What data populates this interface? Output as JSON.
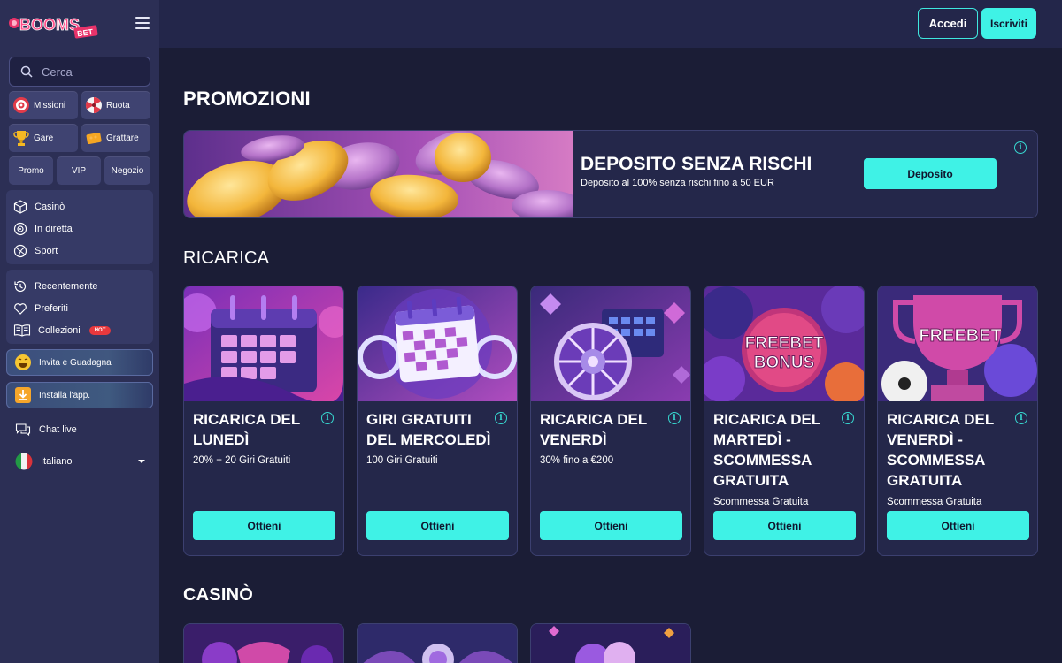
{
  "brand": {
    "logo_text": "BOOMS",
    "logo_tag": "BET"
  },
  "search": {
    "placeholder": "Cerca"
  },
  "quick_tiles": [
    {
      "label": "Missioni",
      "icon": "target-icon"
    },
    {
      "label": "Ruota",
      "icon": "wheel-icon"
    },
    {
      "label": "Gare",
      "icon": "trophy-icon"
    },
    {
      "label": "Grattare",
      "icon": "scratch-card-icon"
    }
  ],
  "small_tiles": [
    "Promo",
    "VIP",
    "Negozio"
  ],
  "nav_primary": [
    {
      "label": "Casinò",
      "icon": "dice-icon"
    },
    {
      "label": "In diretta",
      "icon": "live-icon"
    },
    {
      "label": "Sport",
      "icon": "ball-icon"
    }
  ],
  "nav_secondary": [
    {
      "label": "Recentemente",
      "icon": "history-icon"
    },
    {
      "label": "Preferiti",
      "icon": "heart-icon"
    },
    {
      "label": "Collezioni",
      "icon": "book-icon",
      "badge": "HOT"
    }
  ],
  "invite": {
    "label": "Invita e Guadagna"
  },
  "install": {
    "label": "Installa l'app."
  },
  "chat": {
    "label": "Chat live"
  },
  "language": {
    "label": "Italiano"
  },
  "header": {
    "login": "Accedi",
    "signup": "Iscriviti"
  },
  "sections": {
    "promo": "PROMOZIONI",
    "reload": "RICARICA",
    "casino": "CASINÒ"
  },
  "hero": {
    "title": "DEPOSITO SENZA RISCHI",
    "subtitle": "Deposito al 100% senza rischi fino a 50 EUR",
    "button": "Deposito"
  },
  "cards": [
    {
      "title": "RICARICA DEL LUNEDÌ",
      "desc": "20% + 20 Giri Gratuiti",
      "button": "Ottieni"
    },
    {
      "title": "GIRI GRATUITI DEL MERCOLEDÌ",
      "desc": "100 Giri Gratuiti",
      "button": "Ottieni"
    },
    {
      "title": "RICARICA DEL VENERDÌ",
      "desc": "30% fino a €200",
      "button": "Ottieni"
    },
    {
      "title": "RICARICA DEL MARTEDÌ - SCOMMESSA GRATUITA",
      "desc": "Scommessa Gratuita",
      "button": "Ottieni",
      "img_text_1": "FREEBET",
      "img_text_2": "BONUS"
    },
    {
      "title": "RICARICA DEL VENERDÌ - SCOMMESSA GRATUITA",
      "desc": "Scommessa Gratuita",
      "button": "Ottieni",
      "img_text_1": "FREEBET"
    }
  ],
  "colors": {
    "accent": "#3ff2e6",
    "bg": "#1b1d36",
    "sidebar": "#2c2f55",
    "hot": "#e8383d"
  }
}
